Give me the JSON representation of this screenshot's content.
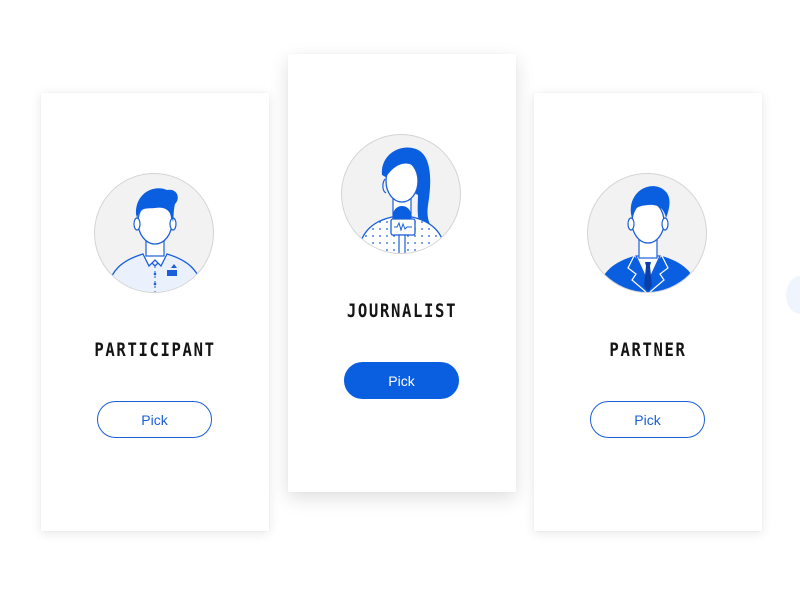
{
  "colors": {
    "accent": "#0a5ee0",
    "card_bg": "#ffffff",
    "avatar_bg": "#f2f2f2"
  },
  "cards": [
    {
      "role": "PARTICIPANT",
      "button_label": "Pick",
      "selected": false,
      "icon": "participant-avatar-icon"
    },
    {
      "role": "JOURNALIST",
      "button_label": "Pick",
      "selected": true,
      "icon": "journalist-avatar-icon"
    },
    {
      "role": "PARTNER",
      "button_label": "Pick",
      "selected": false,
      "icon": "partner-avatar-icon"
    }
  ]
}
